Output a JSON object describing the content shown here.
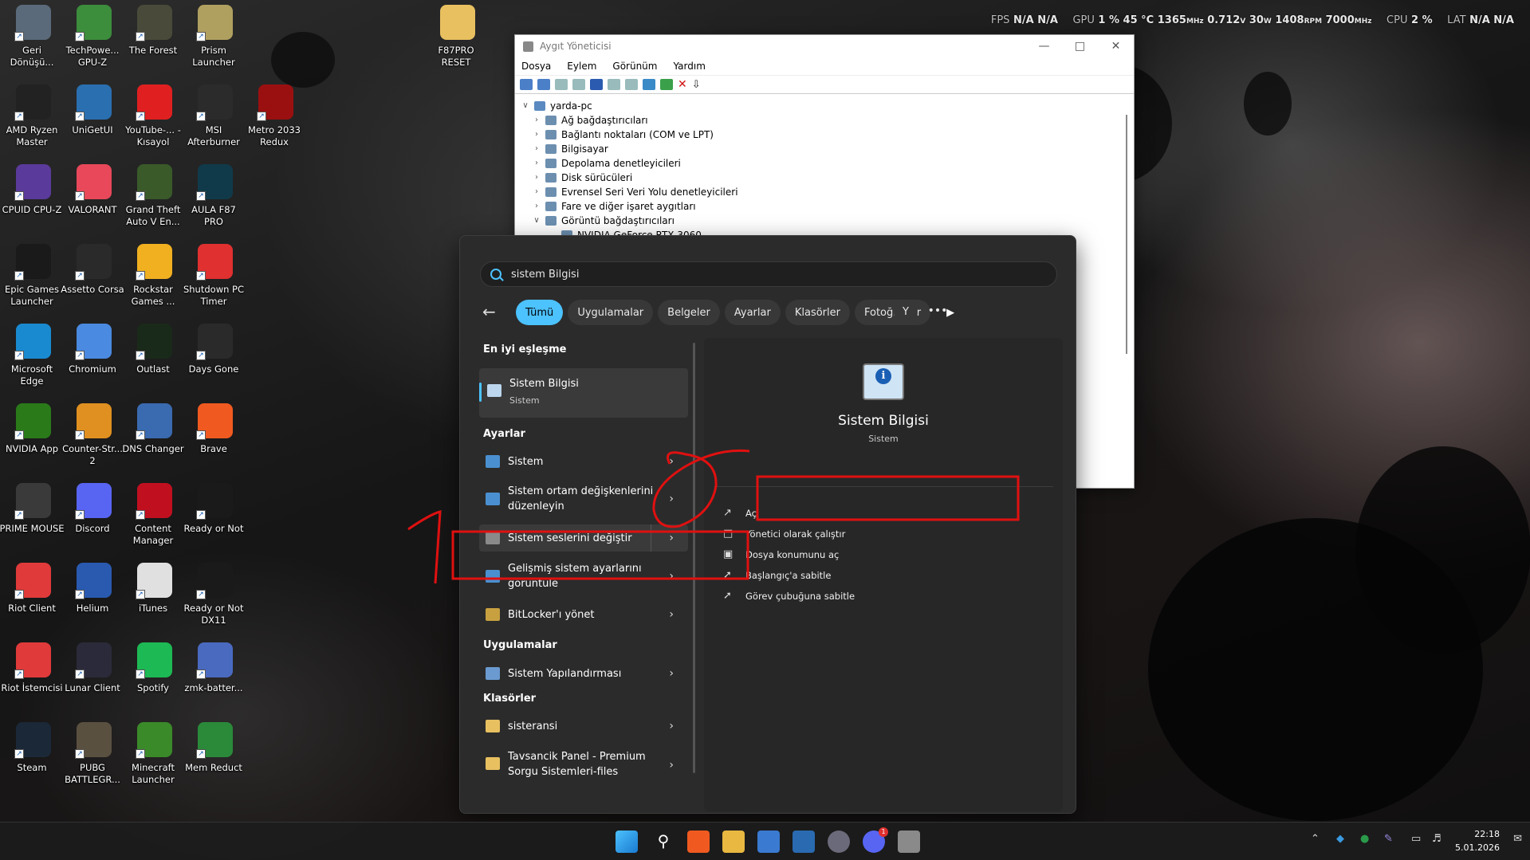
{
  "osd": {
    "fps_label": "FPS",
    "fps1": "N/A",
    "fps2": "N/A",
    "gpu_label": "GPU",
    "gpu_load": "1 %",
    "gpu_temp": "45 °C",
    "gpu_clock": "1365",
    "gpu_clock_unit": "MHz",
    "gpu_volt": "0.712",
    "gpu_volt_unit": "V",
    "gpu_power": "30",
    "gpu_power_unit": "W",
    "gpu_fan": "1408",
    "gpu_fan_unit": "RPM",
    "gpu_mem": "7000",
    "gpu_mem_unit": "MHz",
    "cpu_label": "CPU",
    "cpu_load": "2 %",
    "lat_label": "LAT",
    "lat1": "N/A",
    "lat2": "N/A"
  },
  "desktop_icons": [
    {
      "label": "Geri Dönüşü...",
      "color": "#5a6a7a"
    },
    {
      "label": "TechPowe... GPU-Z",
      "color": "#3c8d3c"
    },
    {
      "label": "The Forest",
      "color": "#4a4a3a"
    },
    {
      "label": "Prism Launcher",
      "color": "#b0a060"
    },
    {
      "label": "AMD Ryzen Master",
      "color": "#222222"
    },
    {
      "label": "UniGetUI",
      "color": "#2a6fb0"
    },
    {
      "label": "YouTube-... - Kısayol",
      "color": "#e02020"
    },
    {
      "label": "MSI Afterburner",
      "color": "#2b2b2b"
    },
    {
      "label": "Metro 2033 Redux",
      "color": "#9a1010"
    },
    {
      "label": "CPUID CPU-Z",
      "color": "#5a3a9a"
    },
    {
      "label": "VALORANT",
      "color": "#e8485a"
    },
    {
      "label": "Grand Theft Auto V En...",
      "color": "#3a5a2a"
    },
    {
      "label": "AULA F87 PRO",
      "color": "#103a4a"
    },
    {
      "label": "Epic Games Launcher",
      "color": "#1a1a1a"
    },
    {
      "label": "Assetto Corsa",
      "color": "#2a2a2a"
    },
    {
      "label": "Rockstar Games ...",
      "color": "#f0b020"
    },
    {
      "label": "Shutdown PC Timer",
      "color": "#e03030"
    },
    {
      "label": "Microsoft Edge",
      "color": "#1a8ad0"
    },
    {
      "label": "Chromium",
      "color": "#4a8ae0"
    },
    {
      "label": "Outlast",
      "color": "#1a2a1a"
    },
    {
      "label": "Days Gone",
      "color": "#2a2a2a"
    },
    {
      "label": "NVIDIA App",
      "color": "#2a7a1a"
    },
    {
      "label": "Counter-Str... 2",
      "color": "#e09020"
    },
    {
      "label": "DNS Changer",
      "color": "#3a6ab0"
    },
    {
      "label": "Brave",
      "color": "#f05a20"
    },
    {
      "label": "PRIME MOUSE",
      "color": "#3a3a3a"
    },
    {
      "label": "Discord",
      "color": "#5865f2"
    },
    {
      "label": "Content Manager",
      "color": "#c01020"
    },
    {
      "label": "Ready or Not",
      "color": "#1a1a1a"
    },
    {
      "label": "Riot Client",
      "color": "#e03a3a"
    },
    {
      "label": "Helium",
      "color": "#2a5ab0"
    },
    {
      "label": "iTunes",
      "color": "#e0e0e0"
    },
    {
      "label": "Ready or Not DX11",
      "color": "#1a1a1a"
    },
    {
      "label": "Riot İstemcisi",
      "color": "#e03a3a"
    },
    {
      "label": "Lunar Client",
      "color": "#2a2a3a"
    },
    {
      "label": "Spotify",
      "color": "#1db954"
    },
    {
      "label": "zmk-batter...",
      "color": "#4a6ac0"
    },
    {
      "label": "Steam",
      "color": "#1b2838"
    },
    {
      "label": "PUBG BATTLEGR...",
      "color": "#5a5040"
    },
    {
      "label": "Minecraft Launcher",
      "color": "#3a8a2a"
    },
    {
      "label": "Mem Reduct",
      "color": "#2a8a3a"
    },
    {
      "label": "F87PRO RESET",
      "color": "#e8c060"
    }
  ],
  "device_manager": {
    "title": "Aygıt Yöneticisi",
    "menu": [
      "Dosya",
      "Eylem",
      "Görünüm",
      "Yardım"
    ],
    "root": "yarda-pc",
    "nodes": [
      "Ağ bağdaştırıcıları",
      "Bağlantı noktaları (COM ve LPT)",
      "Bilgisayar",
      "Depolama denetleyicileri",
      "Disk sürücüleri",
      "Evrensel Seri Veri Yolu denetleyicileri",
      "Fare ve diğer işaret aygıtları",
      "Görüntü bağdaştırıcıları",
      "NVIDIA GeForce RTX 3060"
    ]
  },
  "search": {
    "query": "sistem Bilgisi",
    "filters": [
      "Tümü",
      "Uygulamalar",
      "Belgeler",
      "Ayarlar",
      "Klasörler",
      "Fotoğraflar"
    ],
    "avatar": "Y",
    "sections": {
      "best": "En iyi eşleşme",
      "settings": "Ayarlar",
      "apps": "Uygulamalar",
      "folders": "Klasörler"
    },
    "best_match": {
      "title": "Sistem Bilgisi",
      "subtitle": "Sistem"
    },
    "settings_items": [
      "Sistem",
      "Sistem ortam değişkenlerini düzenleyin",
      "Sistem seslerini değiştir",
      "Gelişmiş sistem ayarlarını görüntüle",
      "BitLocker'ı yönet"
    ],
    "app_items": [
      "Sistem Yapılandırması"
    ],
    "folder_items": [
      "sisteransi",
      "Tavsancik Panel - Premium Sorgu Sistemleri-files"
    ],
    "detail": {
      "title": "Sistem Bilgisi",
      "subtitle": "Sistem",
      "actions": [
        "Aç",
        "Yönetici olarak çalıştır",
        "Dosya konumunu aç",
        "Başlangıç'a sabitle",
        "Görev çubuğuna sabitle"
      ]
    }
  },
  "annotations": {
    "one": "1",
    "two": "2"
  },
  "taskbar": {
    "time": "22:18",
    "date": "5.01.2026",
    "discord_badge": "1"
  }
}
